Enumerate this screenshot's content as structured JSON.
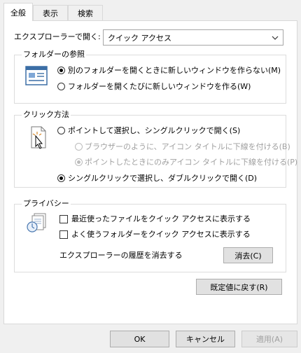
{
  "tabs": [
    {
      "label": "全般",
      "active": true
    },
    {
      "label": "表示",
      "active": false
    },
    {
      "label": "検索",
      "active": false
    }
  ],
  "explorer_open": {
    "label": "エクスプローラーで開く:",
    "selected": "クイック アクセス"
  },
  "folder_browse": {
    "legend": "フォルダーの参照",
    "options": [
      {
        "label": "別のフォルダーを開くときに新しいウィンドウを作らない(M)",
        "checked": true
      },
      {
        "label": "フォルダーを開くたびに新しいウィンドウを作る(W)",
        "checked": false
      }
    ]
  },
  "click_method": {
    "legend": "クリック方法",
    "options": [
      {
        "label": "ポイントして選択し、シングルクリックで開く(S)",
        "checked": false,
        "disabled": false
      },
      {
        "label": "ブラウザーのように、アイコン タイトルに下線を付ける(B)",
        "checked": false,
        "disabled": true
      },
      {
        "label": "ポイントしたときにのみアイコン タイトルに下線を付ける(P)",
        "checked": true,
        "disabled": true
      },
      {
        "label": "シングルクリックで選択し、ダブルクリックで開く(D)",
        "checked": true,
        "disabled": false
      }
    ]
  },
  "privacy": {
    "legend": "プライバシー",
    "checks": [
      {
        "label": "最近使ったファイルをクイック アクセスに表示する",
        "checked": false
      },
      {
        "label": "よく使うフォルダーをクイック アクセスに表示する",
        "checked": false
      }
    ],
    "clear_label": "エクスプローラーの履歴を消去する",
    "clear_button": "消去(C)"
  },
  "restore_defaults": "既定値に戻す(R)",
  "footer": {
    "ok": "OK",
    "cancel": "キャンセル",
    "apply": "適用(A)"
  }
}
